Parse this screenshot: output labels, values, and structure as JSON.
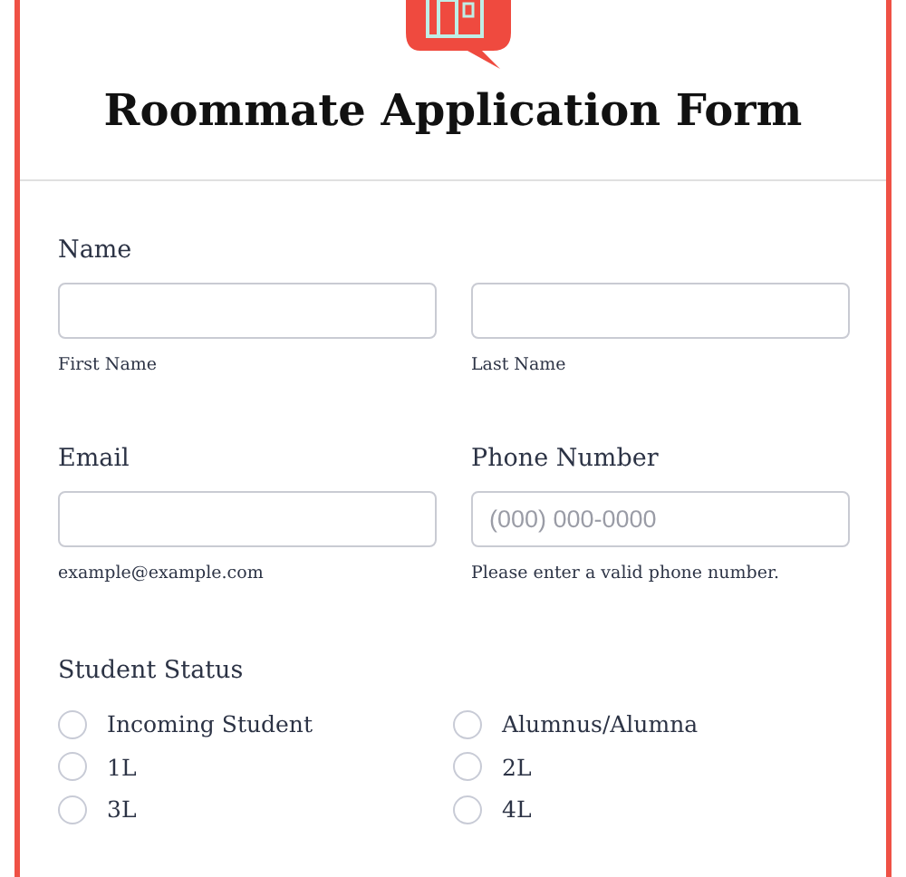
{
  "title": "Roommate Application Form",
  "name": {
    "label": "Name",
    "fields": [
      {
        "sublabel": "First Name"
      },
      {
        "sublabel": "Last Name"
      }
    ]
  },
  "contact": [
    {
      "label": "Email",
      "sublabel": "example@example.com"
    },
    {
      "label": "Phone Number",
      "placeholder": "(000) 000-0000",
      "sublabel": "Please enter a valid phone number."
    }
  ],
  "student_status": {
    "label": "Student Status",
    "options": [
      {
        "label": "Incoming Student",
        "selected": false
      },
      {
        "label": "Alumnus/Alumna",
        "selected": false
      },
      {
        "label": "1L",
        "selected": false
      },
      {
        "label": "2L",
        "selected": false
      },
      {
        "label": "3L",
        "selected": false
      },
      {
        "label": "4L",
        "selected": false
      }
    ]
  }
}
